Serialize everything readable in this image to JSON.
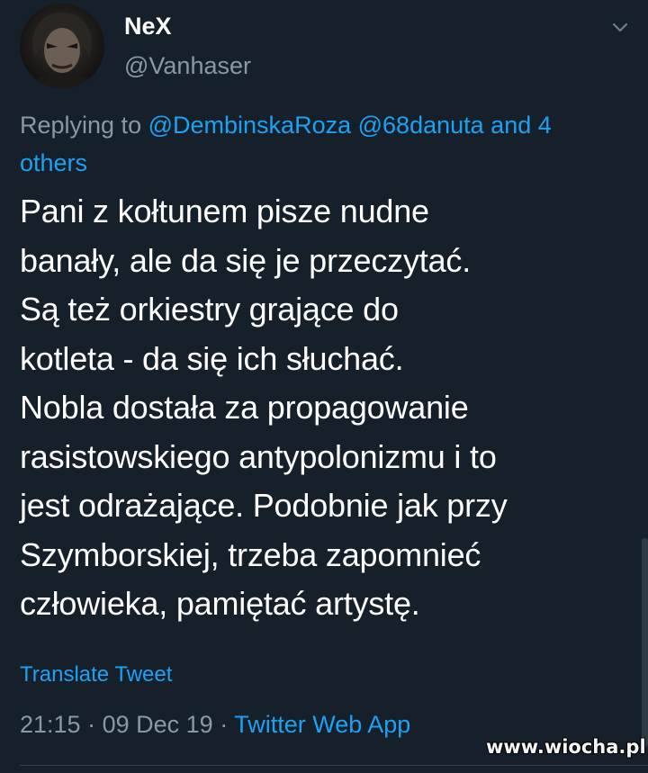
{
  "author": {
    "display_name": "NeX",
    "handle": "@Vanhaser"
  },
  "reply": {
    "prefix": "Replying to",
    "mention_1": "@DembinskaRoza",
    "mention_2": "@68danuta",
    "others_line_1": "and 4",
    "others_line_2": "others"
  },
  "tweet": {
    "lines": [
      "Pani z kołtunem pisze nudne",
      "banały, ale da się je przeczytać.",
      "Są też orkiestry grające do",
      "kotleta - da się ich słuchać.",
      "Nobla dostała za propagowanie",
      "rasistowskiego antypolonizmu i to",
      "jest odrażające. Podobnie jak przy",
      "Szymborskiej, trzeba zapomnieć",
      "człowieka, pamiętać artystę."
    ]
  },
  "translate_label": "Translate Tweet",
  "meta": {
    "time": "21:15",
    "separator": "·",
    "date": "09 Dec 19",
    "source": "Twitter Web App"
  },
  "watermark": "www.wiocha.pl",
  "icons": {
    "caret": "chevron-down-icon"
  },
  "colors": {
    "background": "#15202b",
    "primary_text": "#ffffff",
    "secondary_text": "#8899a6",
    "link": "#1da1f2"
  }
}
